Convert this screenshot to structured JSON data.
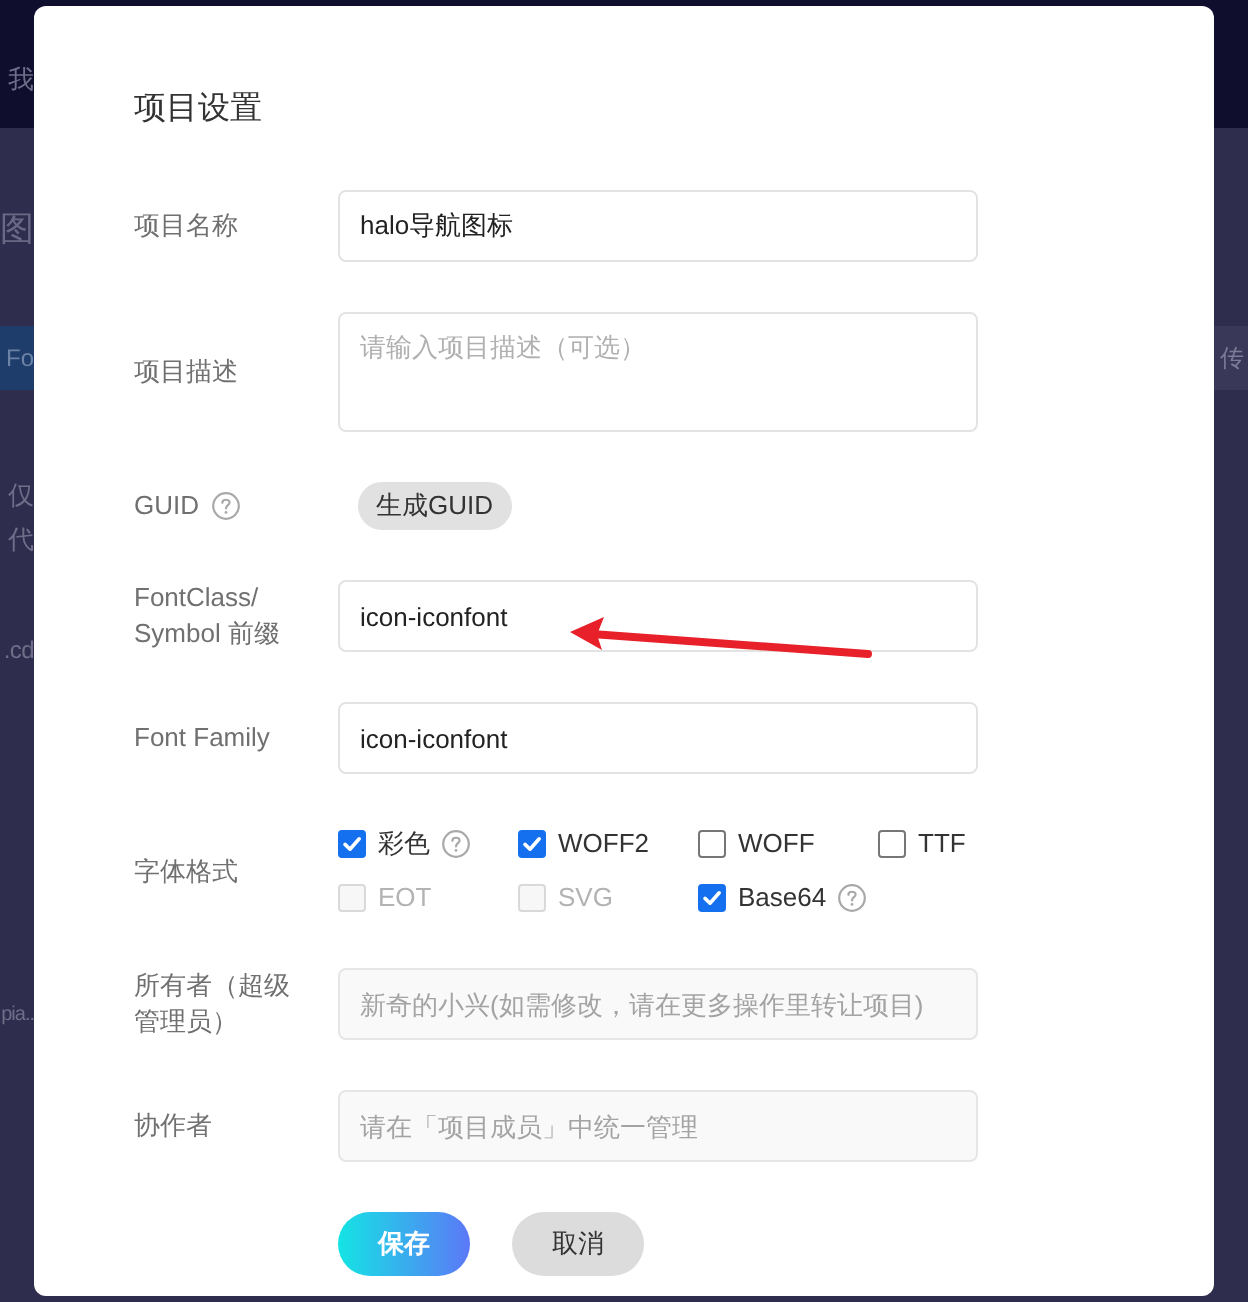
{
  "background": {
    "nav_text": "我",
    "heading": "图",
    "button": "Fo",
    "side_texts": [
      "仅",
      "代",
      ".cd",
      "pia.."
    ],
    "right_button": "传"
  },
  "dialog": {
    "title": "项目设置",
    "fields": [
      {
        "kind": "input",
        "label": "项目名称",
        "value": "halo导航图标",
        "disabled": false
      },
      {
        "kind": "textarea",
        "label": "项目描述",
        "placeholder": "请输入项目描述（可选）",
        "disabled": false
      },
      {
        "kind": "guid",
        "label": "GUID",
        "help": true,
        "button": "生成GUID"
      },
      {
        "kind": "input",
        "label": "FontClass/ Symbol 前缀",
        "value": "icon-iconfont",
        "disabled": false
      },
      {
        "kind": "input",
        "label": "Font Family",
        "value": "icon-iconfont",
        "disabled": false
      },
      {
        "kind": "checkboxes",
        "label": "字体格式",
        "options": [
          {
            "label": "彩色",
            "checked": true,
            "disabled": false,
            "help": true
          },
          {
            "label": "WOFF2",
            "checked": true,
            "disabled": false,
            "help": false
          },
          {
            "label": "WOFF",
            "checked": false,
            "disabled": false,
            "help": false
          },
          {
            "label": "TTF",
            "checked": false,
            "disabled": false,
            "help": false
          },
          {
            "label": "EOT",
            "checked": false,
            "disabled": true,
            "help": false
          },
          {
            "label": "SVG",
            "checked": false,
            "disabled": true,
            "help": false
          },
          {
            "label": "Base64",
            "checked": true,
            "disabled": false,
            "help": true
          }
        ]
      },
      {
        "kind": "input",
        "label": "所有者（超级管理员）",
        "placeholder": "新奇的小兴(如需修改，请在更多操作里转让项目)",
        "disabled": true
      },
      {
        "kind": "input",
        "label": "协作者",
        "placeholder": "请在「项目成员」中统一管理",
        "disabled": true
      }
    ],
    "buttons": [
      {
        "label": "保存",
        "kind": "primary"
      },
      {
        "label": "取消",
        "kind": "secondary"
      }
    ]
  }
}
